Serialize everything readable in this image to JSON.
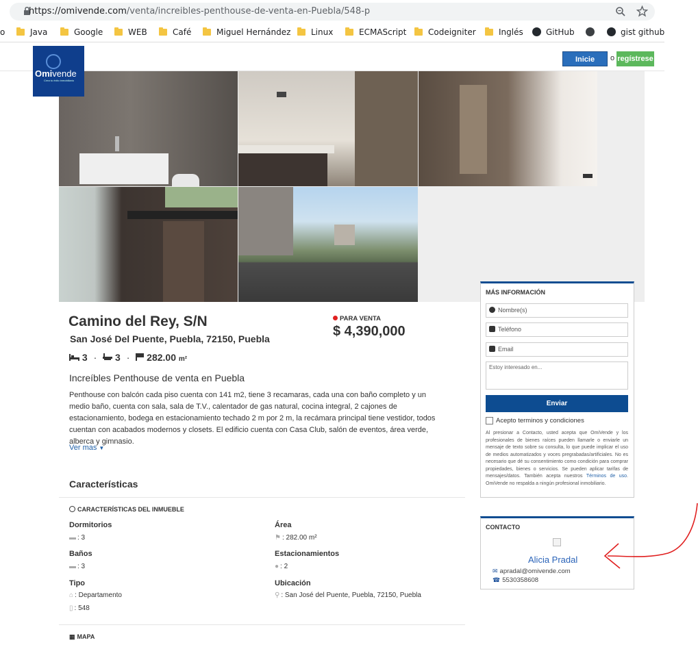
{
  "browser": {
    "url_host": "https://omivende.com",
    "url_path": "/venta/increibles-penthouse-de-venta-en-Puebla/548-p",
    "bookmarks": [
      "o",
      "Java",
      "Google",
      "WEB",
      "Café",
      "Miguel Hernández",
      "Linux",
      "ECMAScript",
      "Codeigniter",
      "Inglés",
      "GitHub",
      "gist github"
    ]
  },
  "header": {
    "logo_main": "Omi",
    "logo_accent": "vende",
    "logo_sub": "Crea tu éxito inmobiliario",
    "login_label": "Inicie sesión",
    "or_label": "o",
    "register_label": "regístrese"
  },
  "listing": {
    "title": "Camino del Rey, S/N",
    "address": "San José Del Puente, Puebla, 72150, Puebla",
    "status": "PARA VENTA",
    "price": "$ 4,390,000",
    "bedrooms": "3",
    "bathrooms": "3",
    "area": "282.00",
    "area_unit": "m²",
    "subtitle": "Increíbles Penthouse de venta en Puebla",
    "description": "Penthouse con balcón cada piso cuenta con 141 m2, tiene 3 recamaras, cada una con baño completo y un medio baño, cuenta con sala, sala de T.V., calentador de gas natural, cocina integral, 2 cajones de estacionamiento, bodega en estacionamiento techado 2 m por 2 m, la recámara principal tiene vestidor, todos cuentan con acabados modernos y closets. El edificio cuenta con Casa Club, salón de eventos, área verde, alberca y gimnasio.",
    "more_label": "Ver mas",
    "features_heading": "Características",
    "property_heading": "CARACTERÍSTICAS DEL INMUEBLE",
    "features": {
      "bedrooms_label": "Dormitorios",
      "bedrooms_value": ": 3",
      "area_label": "Área",
      "area_value": ": 282.00 m²",
      "bathrooms_label": "Baños",
      "bathrooms_value": ": 3",
      "parking_label": "Estacionamientos",
      "parking_value": ": 2",
      "type_label": "Tipo",
      "type_value": ": Departamento",
      "id_value": ": 548",
      "location_label": "Ubicación",
      "location_value": ": San José del Puente, Puebla, 72150, Puebla"
    },
    "map_heading": "MAPA"
  },
  "info_form": {
    "title": "MÁS INFORMACIÓN",
    "name_placeholder": "Nombre(s)",
    "phone_placeholder": "Teléfono",
    "email_placeholder": "Email",
    "message_placeholder": "Estoy interesado en...",
    "send_label": "Enviar",
    "terms_label": "Acepto terminos y condiciones",
    "disclaimer_a": "Al presionar a Contacto, usted acepta que OmiVende y los profesionales de bienes raíces pueden llamarle o enviarle un mensaje de texto sobre su consulta, lo que puede implicar el uso de medios automatizados y voces pregrabadas/artificiales. No es necesario que dé su consentimiento como condición para comprar propiedades, bienes o servicios. Se pueden aplicar tarifas de mensajes/datos. También acepta nuestros ",
    "disclaimer_link": "Términos de uso",
    "disclaimer_b": ". OmiVende no respalda a ningún profesional inmobiliario."
  },
  "contact": {
    "title": "CONTACTO",
    "agent_name": "Alicia Pradal",
    "agent_email": "apradal@omivende.com",
    "agent_phone": "5530358608"
  },
  "colors": {
    "brand_blue": "#0d4c91",
    "login_blue": "#2a6ebb",
    "register_green": "#5cb85c",
    "status_red": "#e02020",
    "annotation_red": "#e01e1e"
  },
  "icons": [
    "lock-icon",
    "zoom-icon",
    "star-icon",
    "folder-icon",
    "github-icon",
    "bed-icon",
    "bath-icon",
    "area-icon",
    "car-icon",
    "home-icon",
    "building-icon",
    "location-icon",
    "map-icon",
    "check-circle-icon",
    "user-icon",
    "phone-icon",
    "mail-icon",
    "chevron-down-icon"
  ]
}
